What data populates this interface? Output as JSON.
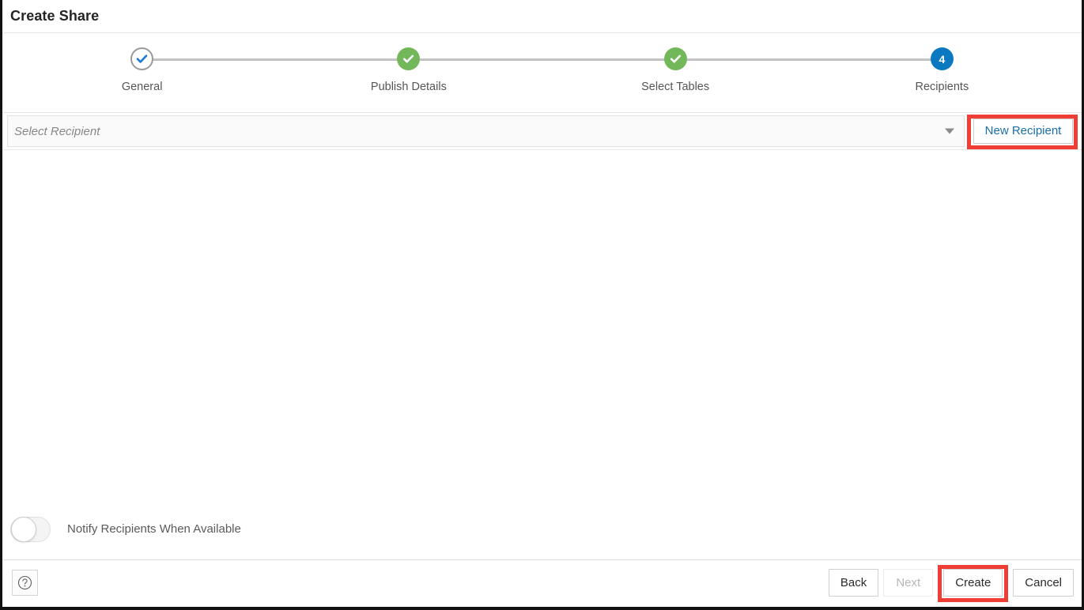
{
  "dialog": {
    "title": "Create Share"
  },
  "stepper": {
    "steps": [
      {
        "label": "General",
        "state": "completed-outline",
        "marker": "check-blue"
      },
      {
        "label": "Publish Details",
        "state": "completed",
        "marker": "check-white"
      },
      {
        "label": "Select Tables",
        "state": "completed",
        "marker": "check-white"
      },
      {
        "label": "Recipients",
        "state": "active",
        "marker": "4"
      }
    ]
  },
  "recipient": {
    "placeholder": "Select Recipient",
    "value": "",
    "dropdown_icon": "chevron-down-icon",
    "new_recipient_label": "New Recipient"
  },
  "notify": {
    "label": "Notify Recipients When Available",
    "enabled": false
  },
  "footer": {
    "help_icon": "help-circle-icon",
    "back_label": "Back",
    "next_label": "Next",
    "next_disabled": true,
    "create_label": "Create",
    "cancel_label": "Cancel"
  },
  "colors": {
    "step_active": "#0b78c2",
    "step_done": "#72b75a",
    "step_check_blue": "#1a7ad1",
    "link": "#1a6ea8",
    "highlight": "#ef3e36",
    "track": "#c2c2c2"
  }
}
